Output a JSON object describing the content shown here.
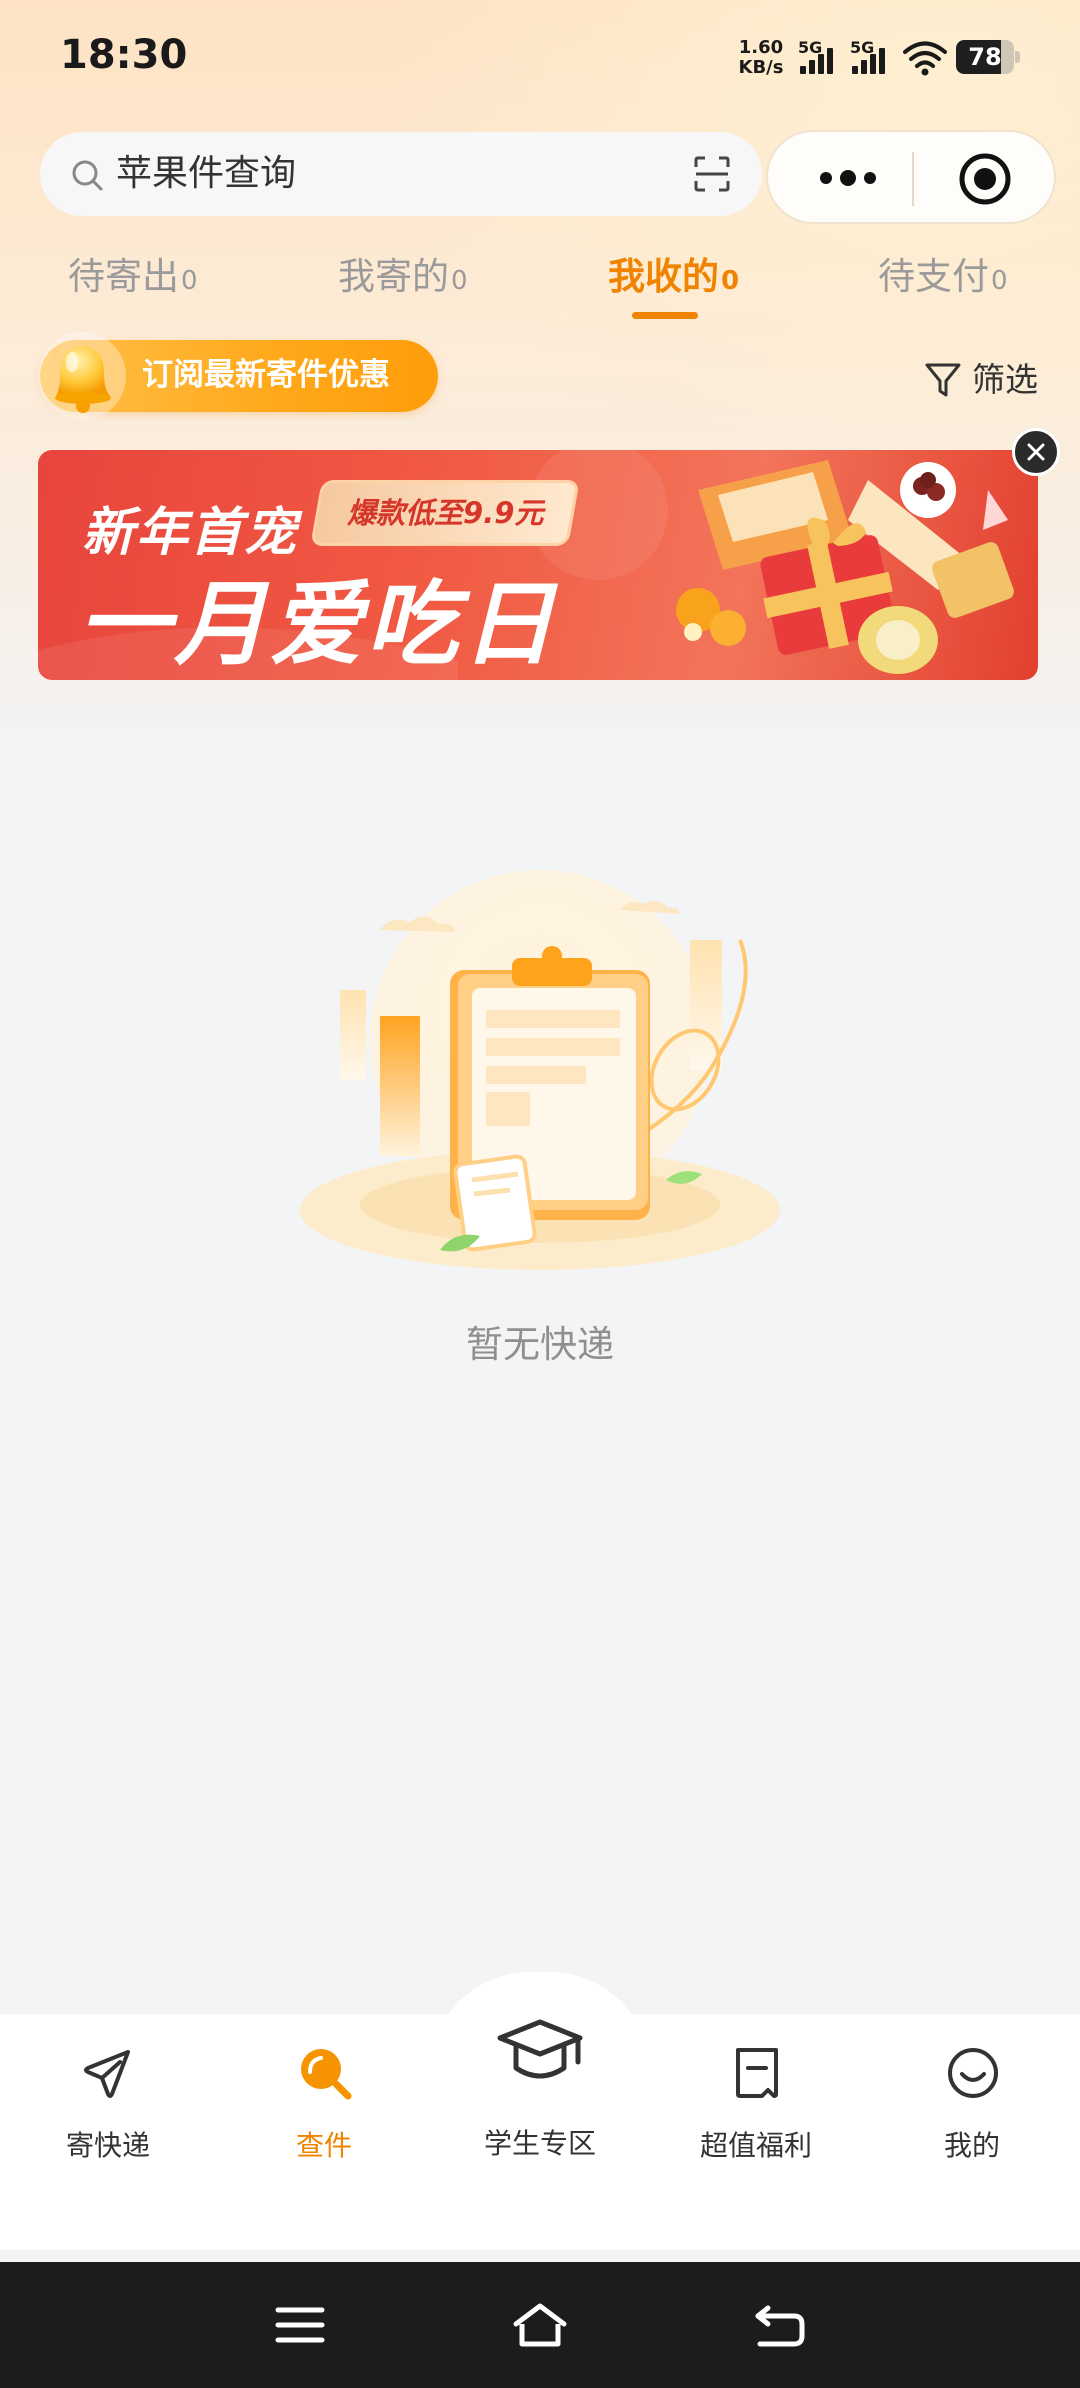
{
  "status_bar": {
    "time": "18:30",
    "net_speed_value": "1.60",
    "net_speed_unit": "KB/s",
    "signal1_label": "5G",
    "signal2_label": "5G",
    "battery_level": "78"
  },
  "search": {
    "text": "苹果件查询"
  },
  "tabs": [
    {
      "label": "待寄出",
      "count": "0",
      "active": false
    },
    {
      "label": "我寄的",
      "count": "0",
      "active": false
    },
    {
      "label": "我收的",
      "count": "0",
      "active": true
    },
    {
      "label": "待支付",
      "count": "0",
      "active": false
    }
  ],
  "subscribe": {
    "label": "订阅最新寄件优惠"
  },
  "filter": {
    "label": "筛选"
  },
  "banner": {
    "line1": "新年首宠",
    "badge": "爆款低至9.9元",
    "line2": "一月爱吃日"
  },
  "empty_state": {
    "text": "暂无快递"
  },
  "bottom_nav": [
    {
      "label": "寄快递",
      "icon": "send-icon",
      "active": false
    },
    {
      "label": "查件",
      "icon": "search-icon",
      "active": true
    },
    {
      "label": "学生专区",
      "icon": "graduation-cap-icon",
      "active": false
    },
    {
      "label": "超值福利",
      "icon": "coupon-icon",
      "active": false
    },
    {
      "label": "我的",
      "icon": "smile-icon",
      "active": false
    }
  ],
  "colors": {
    "accent": "#f08300",
    "tab_inactive": "#9a9a9a",
    "banner_red": "#e8453d"
  }
}
